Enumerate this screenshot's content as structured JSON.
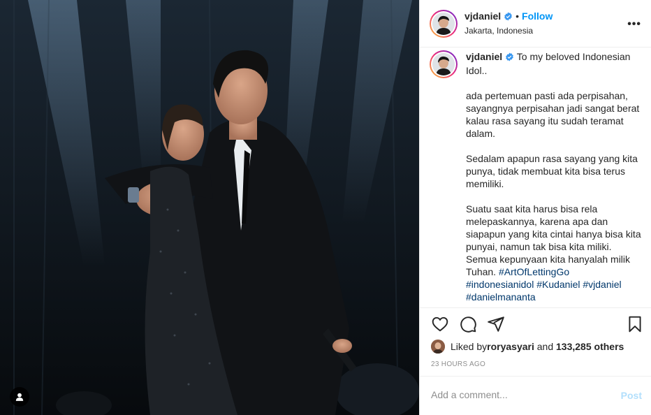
{
  "post": {
    "username": "vjdaniel",
    "follow_label": "Follow",
    "separator": "•",
    "location": "Jakarta, Indonesia",
    "more_label": "•••"
  },
  "caption": {
    "username": "vjdaniel",
    "text": " To my beloved Indonesian Idol..\n\nada pertemuan pasti ada perpisahan, sayangnya perpisahan jadi sangat berat kalau rasa sayang itu sudah teramat dalam.\n\nSedalam apapun rasa sayang yang kita punya, tidak membuat kita bisa terus memiliki.\n\nSuatu saat kita harus bisa rela melepaskannya, karena apa dan siapapun yang kita cintai hanya bisa kita punyai, namun tak bisa kita miliki. Semua kepunyaan kita hanyalah milik Tuhan. ",
    "hashtags": [
      "#ArtOfLettingGo",
      "#indonesianidol",
      "#Kudaniel",
      "#vjdaniel",
      "#danielmananta"
    ]
  },
  "likes": {
    "prefix": "Liked by ",
    "user": "roryasyari",
    "middle": " and ",
    "count": "133,285 others"
  },
  "timestamp": "23 HOURS AGO",
  "comment": {
    "placeholder": "Add a comment...",
    "post_label": "Post"
  },
  "icons": {
    "verified": "verified-badge-icon",
    "like": "heart-icon",
    "comment": "comment-icon",
    "share": "paper-plane-icon",
    "save": "bookmark-icon",
    "tagged": "user-tag-icon"
  },
  "colors": {
    "accent": "#0095f6",
    "hashtag": "#00376b",
    "muted": "#8e8e8e",
    "post_disabled": "#b2dffc"
  }
}
